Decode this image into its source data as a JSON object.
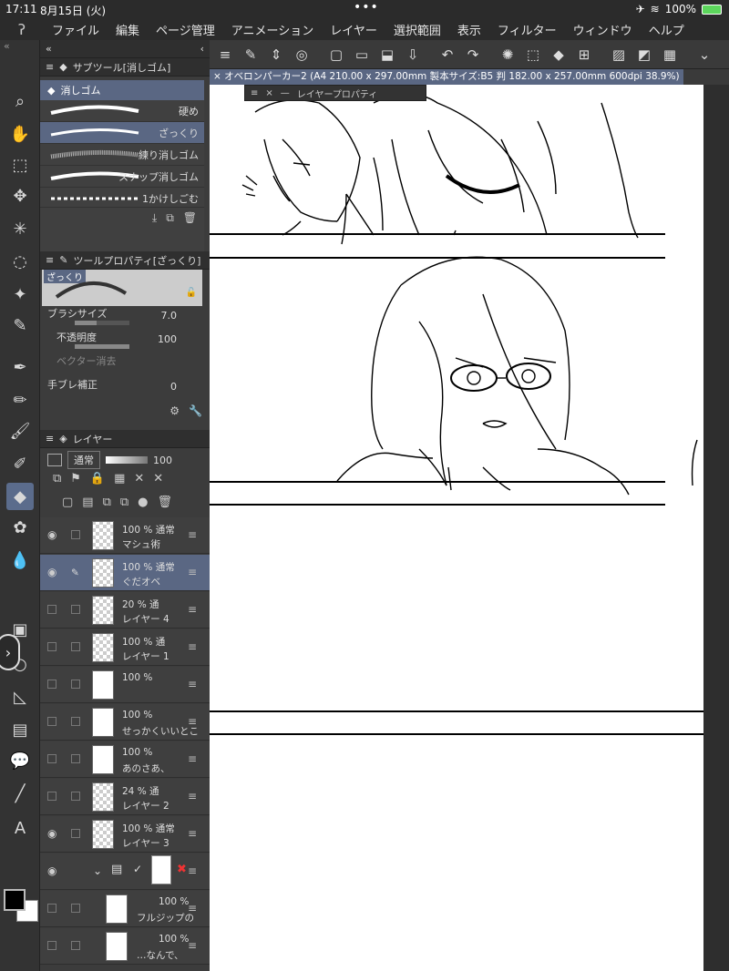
{
  "status": {
    "time": "17:11",
    "date": "8月15日 (火)",
    "battery": "100%"
  },
  "menu": [
    "ファイル",
    "編集",
    "ページ管理",
    "アニメーション",
    "レイヤー",
    "選択範囲",
    "表示",
    "フィルター",
    "ウィンドウ",
    "ヘルプ"
  ],
  "subtool": {
    "title": "サブツール[消しゴム]",
    "group": "消しゴム",
    "items": [
      {
        "label": "硬め"
      },
      {
        "label": "ざっくり"
      },
      {
        "label": "練り消しゴム"
      },
      {
        "label": "スナップ消しゴム"
      },
      {
        "label": "1かけしごむ"
      }
    ]
  },
  "toolprop": {
    "title": "ツールプロパティ[ざっくり]",
    "preset": "ざっくり",
    "brush_size_label": "ブラシサイズ",
    "brush_size": "7.0",
    "opacity_label": "不透明度",
    "opacity": "100",
    "vector_label": "ベクター消去",
    "stabilize_label": "手ブレ補正",
    "stabilize": "0"
  },
  "layers_panel": {
    "title": "レイヤー",
    "blend": "通常",
    "opacity": "100",
    "rows": [
      {
        "pct": "100 % 通常",
        "name": "マシュ術"
      },
      {
        "pct": "100 % 通常",
        "name": "ぐだオベ"
      },
      {
        "pct": "20 % 通",
        "name": "レイヤー 4"
      },
      {
        "pct": "100 % 通",
        "name": "レイヤー 1"
      },
      {
        "pct": "100 %",
        "name": ""
      },
      {
        "pct": "100 %",
        "name": "せっかくいいとこ"
      },
      {
        "pct": "100 %",
        "name": "あのさあ、"
      },
      {
        "pct": "24 % 通",
        "name": "レイヤー 2"
      },
      {
        "pct": "100 % 通常",
        "name": "レイヤー 3"
      },
      {
        "pct": "",
        "name": ""
      },
      {
        "pct": "100 %",
        "name": "フルジップの"
      },
      {
        "pct": "100 %",
        "name": "…なんで、"
      }
    ]
  },
  "document": {
    "tab": "オベロンパーカー2 (A4 210.00 x 297.00mm 製本サイズ:B5 判 182.00 x 257.00mm 600dpi 38.9%)",
    "float_panel": "レイヤープロパティ"
  }
}
